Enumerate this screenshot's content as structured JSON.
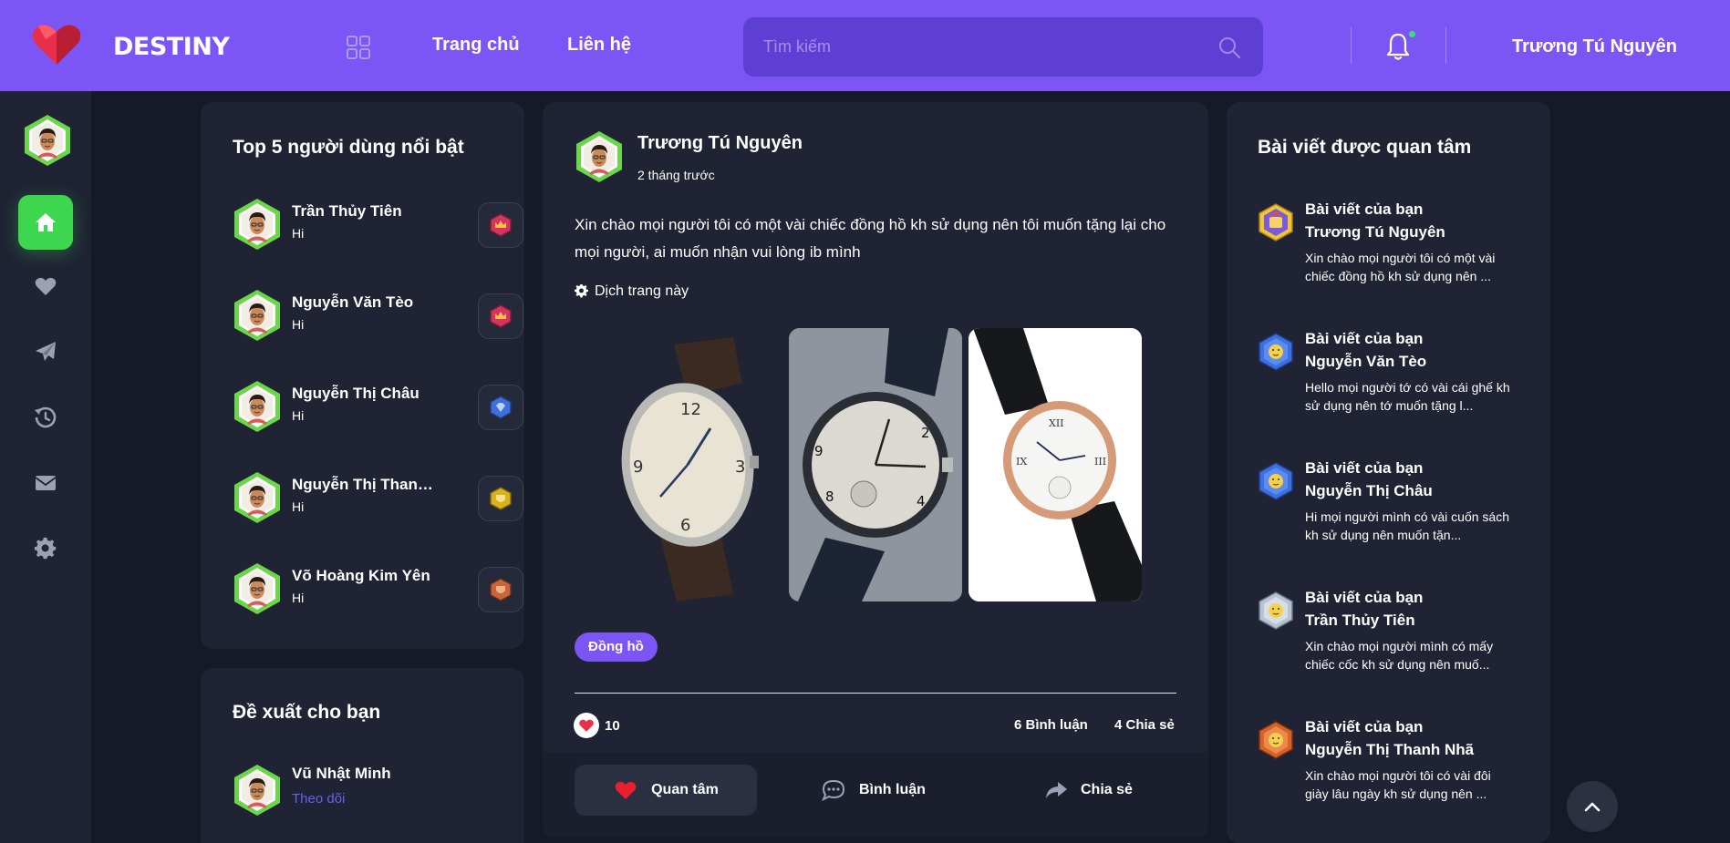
{
  "header": {
    "brand": "DESTINY",
    "nav": {
      "home": "Trang chủ",
      "contact": "Liên hệ"
    },
    "search_placeholder": "Tìm kiếm",
    "user_name": "Trương Tú Nguyên"
  },
  "top_users": {
    "title": "Top 5 người dùng nổi bật",
    "users": [
      {
        "name": "Trần Thủy Tiên",
        "status": "Hi",
        "badge_color": "#d6335f"
      },
      {
        "name": "Nguyễn Văn Tèo",
        "status": "Hi",
        "badge_color": "#d6335f"
      },
      {
        "name": "Nguyễn Thị Châu",
        "status": "Hi",
        "badge_color": "#3f6fd8"
      },
      {
        "name": "Nguyễn Thị Thanh Nhã",
        "status": "Hi",
        "badge_color": "#d8b21e"
      },
      {
        "name": "Võ Hoàng Kim Yên",
        "status": "Hi",
        "badge_color": "#c8663b"
      }
    ]
  },
  "suggest": {
    "title": "Đề xuất cho bạn",
    "users": [
      {
        "name": "Vũ Nhật Minh",
        "action": "Theo dõi"
      }
    ]
  },
  "post": {
    "author": "Trương Tú Nguyên",
    "time": "2 tháng trước",
    "text": "Xin chào mọi người tôi có một vài chiếc đồng hồ kh sử dụng nên tôi muốn tặng lại cho mọi người, ai muốn nhận vui lòng ib mình",
    "translate": "Dịch trang này",
    "tag": "Đồng hồ",
    "likes": "10",
    "comments": "6 Bình luận",
    "shares": "4 Chia sẻ",
    "actions": {
      "like": "Quan tâm",
      "comment": "Bình luận",
      "share": "Chia sẻ"
    }
  },
  "trending": {
    "title": "Bài viết được quan tâm",
    "items": [
      {
        "line1": "Bài viết của bạn",
        "author": "Trương Tú Nguyên",
        "excerpt": "Xin chào mọi người tôi có một vài chiếc đồng hồ kh sử dụng nên ...",
        "badge_color": "#e8b92a"
      },
      {
        "line1": "Bài viết của bạn",
        "author": "Nguyễn Văn Tèo",
        "excerpt": "Hello mọi người tớ có vài cái ghế kh sử dụng nên tớ muốn tặng l...",
        "badge_color": "#3e6fe0"
      },
      {
        "line1": "Bài viết của bạn",
        "author": "Nguyễn Thị Châu",
        "excerpt": "Hi mọi người mình có vài cuốn sách kh sử dụng nên muốn tặn...",
        "badge_color": "#3e6fe0"
      },
      {
        "line1": "Bài viết của bạn",
        "author": "Trần Thủy Tiên",
        "excerpt": "Xin chào mọi người mình có mấy chiếc cốc kh sử dụng nên muố...",
        "badge_color": "#9aa7b8"
      },
      {
        "line1": "Bài viết của bạn",
        "author": "Nguyễn Thị Thanh Nhã",
        "excerpt": "Xin chào mọi người tôi có vài đôi giày lâu ngày kh sử dụng nên ...",
        "badge_color": "#d9622b"
      }
    ]
  },
  "icons": {
    "rail": [
      "home-icon",
      "heart-icon",
      "send-icon",
      "history-icon",
      "mail-icon",
      "gear-icon"
    ]
  },
  "colors": {
    "accent": "#7c56f5",
    "active_green": "#3ed64f",
    "panel": "#1f2333",
    "background": "#161a27"
  }
}
